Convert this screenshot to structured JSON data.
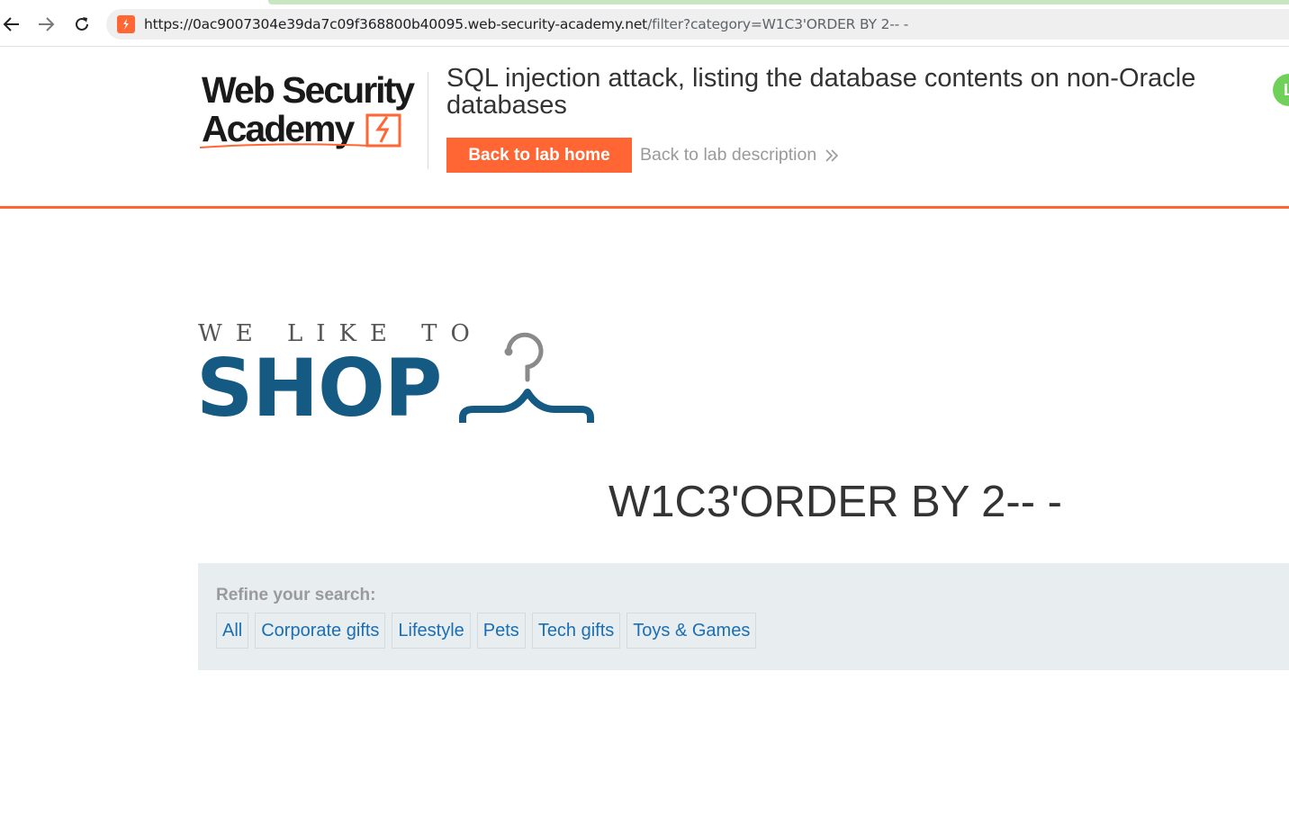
{
  "browser": {
    "url_base": "https://0ac9007304e39da7c09f368800b40095.web-security-academy.net",
    "url_rest": "/filter?category=W1C3'ORDER BY 2-- -",
    "icons": {
      "back": "arrow-left-icon",
      "forward": "arrow-right-icon",
      "reload": "reload-icon",
      "site": "portswigger-icon"
    }
  },
  "header": {
    "logo_line1": "Web Security",
    "logo_line2": "Academy",
    "lab_title": "SQL injection attack, listing the database contents on non-Oracle databases",
    "back_home_label": "Back to lab home",
    "back_description_label": "Back to lab description",
    "avatar_letter": "L",
    "accent_color": "#ff6633"
  },
  "shop": {
    "tagline": "WE LIKE TO",
    "word": "SHOP",
    "brand_color": "#145a82"
  },
  "page": {
    "category_heading": "W1C3'ORDER BY 2-- -"
  },
  "filter": {
    "label": "Refine your search:",
    "categories": [
      "All",
      "Corporate gifts",
      "Lifestyle",
      "Pets",
      "Tech gifts",
      "Toys & Games"
    ]
  }
}
